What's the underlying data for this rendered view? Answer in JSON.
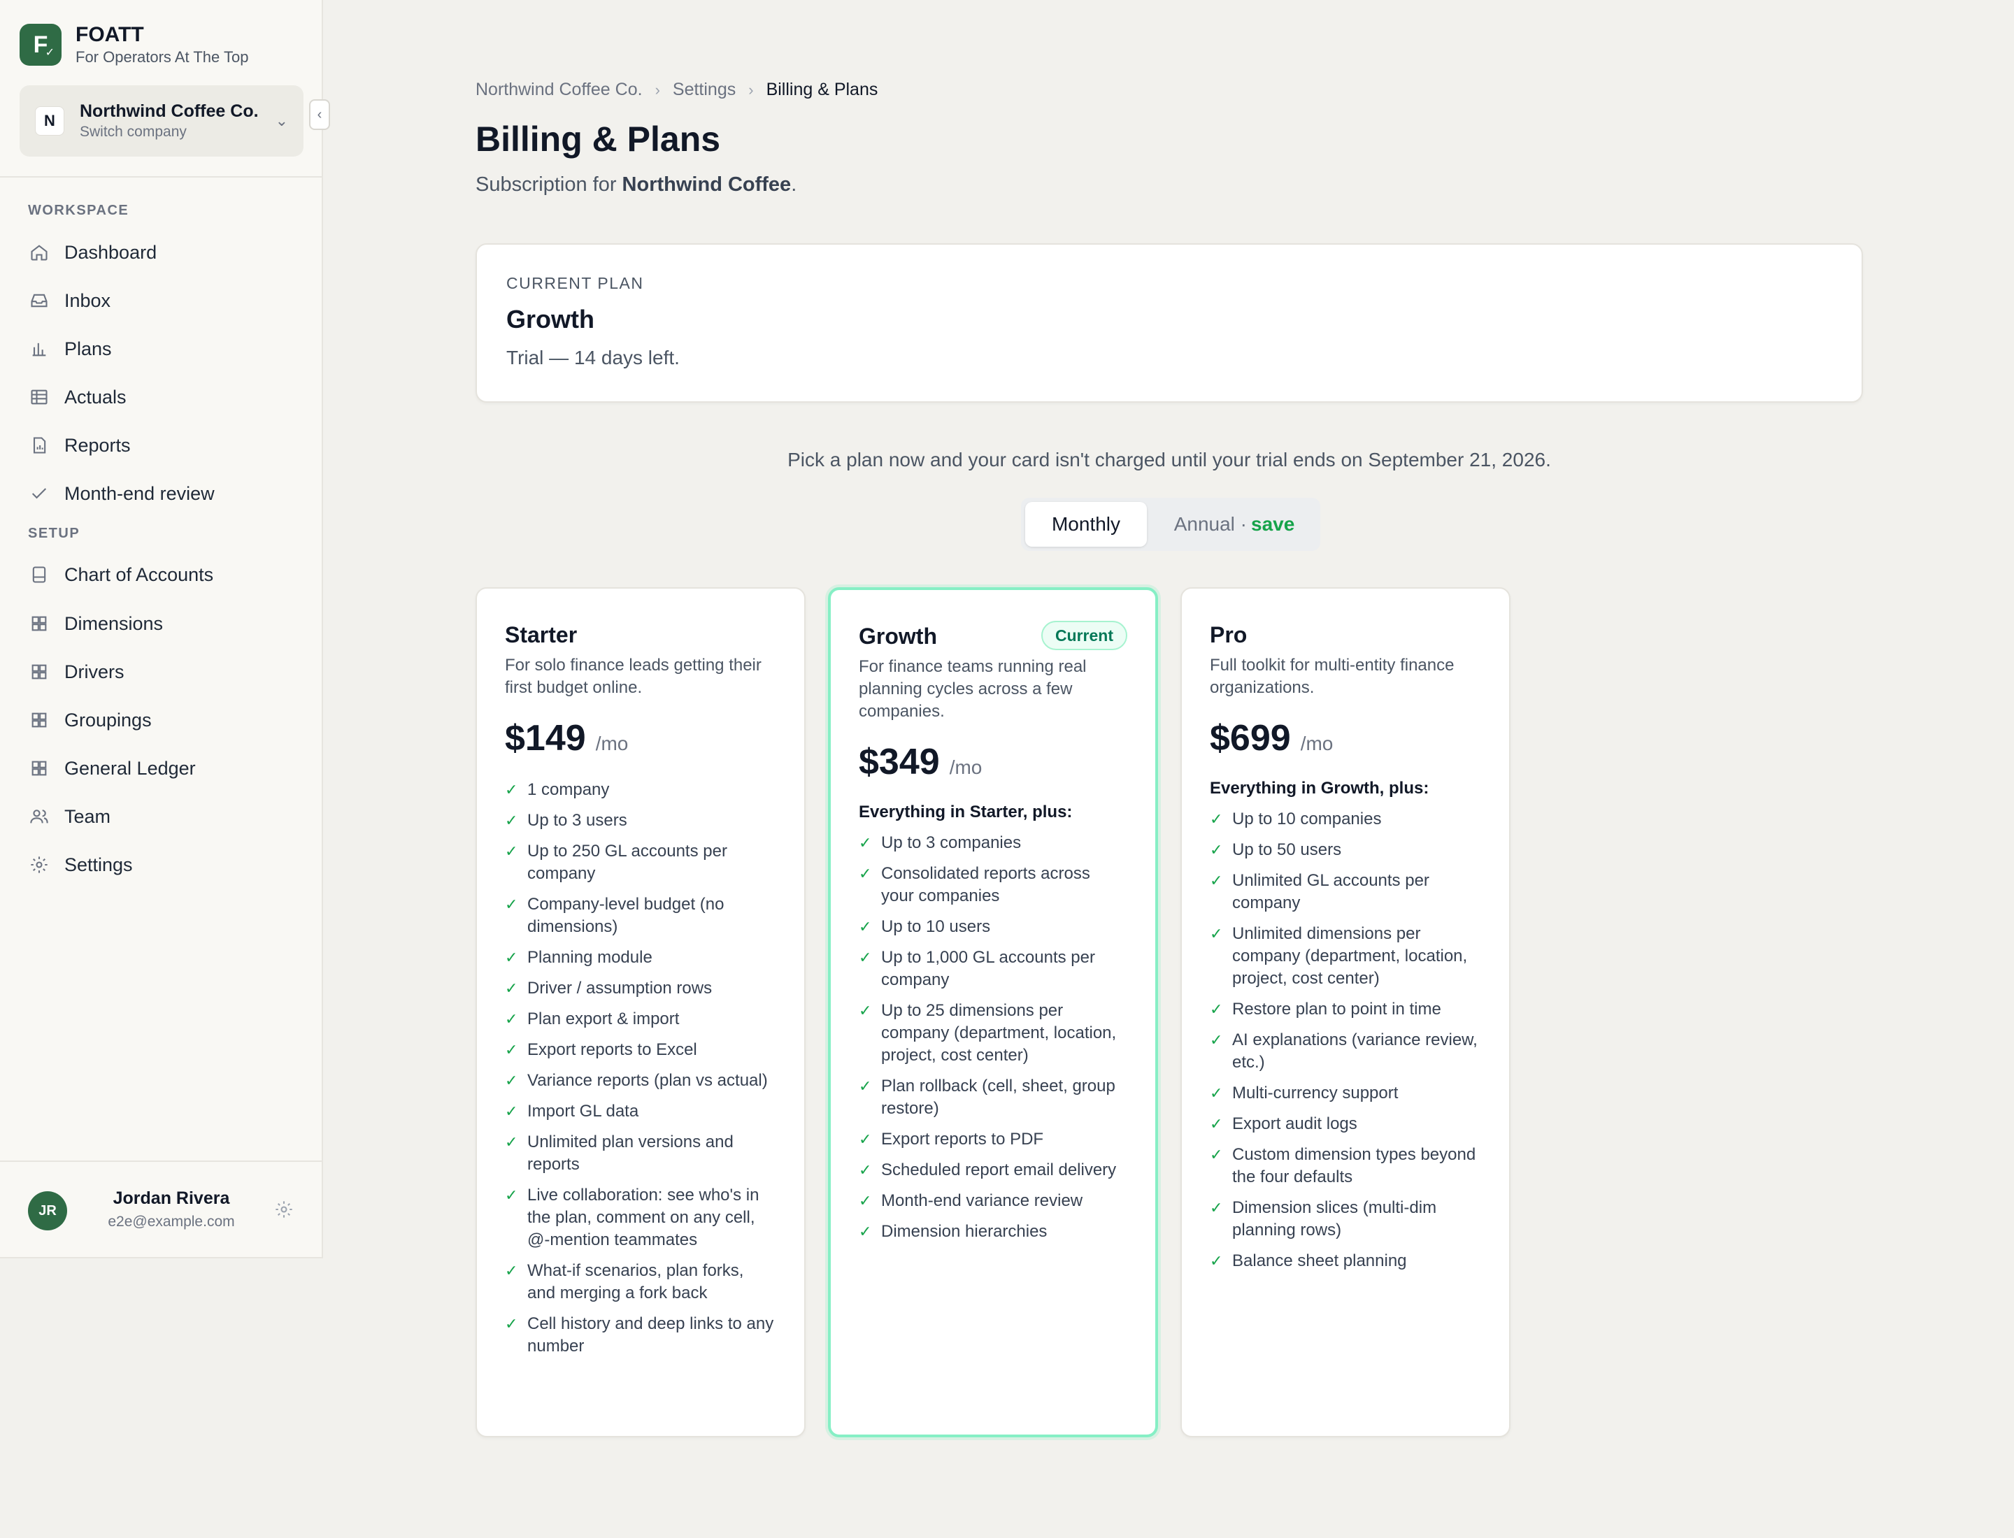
{
  "brand": {
    "logo_letter": "F",
    "name": "FOATT",
    "tagline": "For Operators At The Top"
  },
  "company": {
    "avatar": "N",
    "name": "Northwind Coffee Co.",
    "switch_label": "Switch company"
  },
  "sidebar": {
    "workspace_label": "WORKSPACE",
    "workspace_items": [
      {
        "label": "Dashboard",
        "icon": "home-icon"
      },
      {
        "label": "Inbox",
        "icon": "inbox-icon"
      },
      {
        "label": "Plans",
        "icon": "bar-chart-icon"
      },
      {
        "label": "Actuals",
        "icon": "table-icon"
      },
      {
        "label": "Reports",
        "icon": "report-icon"
      },
      {
        "label": "Month-end review",
        "icon": "check-icon"
      }
    ],
    "setup_label": "SETUP",
    "setup_items": [
      {
        "label": "Chart of Accounts",
        "icon": "ledger-icon"
      },
      {
        "label": "Dimensions",
        "icon": "grid-icon"
      },
      {
        "label": "Drivers",
        "icon": "grid-icon"
      },
      {
        "label": "Groupings",
        "icon": "grid-icon"
      },
      {
        "label": "General Ledger",
        "icon": "grid-icon"
      },
      {
        "label": "Team",
        "icon": "users-icon"
      },
      {
        "label": "Settings",
        "icon": "gear-icon"
      }
    ]
  },
  "user": {
    "initials": "JR",
    "name": "Jordan Rivera",
    "email": "e2e@example.com"
  },
  "breadcrumb": [
    "Northwind Coffee Co.",
    "Settings",
    "Billing & Plans"
  ],
  "page": {
    "title": "Billing & Plans",
    "subtitle_prefix": "Subscription for ",
    "subtitle_company": "Northwind Coffee",
    "subtitle_suffix": "."
  },
  "current_plan": {
    "label": "CURRENT PLAN",
    "name": "Growth",
    "trial": "Trial — 14 days left."
  },
  "notice": "Pick a plan now and your card isn't charged until your trial ends on September 21, 2026.",
  "billing_toggle": {
    "monthly": "Monthly",
    "annual": "Annual ·",
    "annual_save": "save",
    "selected": "Monthly"
  },
  "plans": [
    {
      "name": "Starter",
      "badge": "",
      "description": "For solo finance leads getting their first budget online.",
      "price": "$149",
      "period": "/mo",
      "intro": "",
      "features": [
        "1 company",
        "Up to 3 users",
        "Up to 250 GL accounts per company",
        "Company-level budget (no dimensions)",
        "Planning module",
        "Driver / assumption rows",
        "Plan export & import",
        "Export reports to Excel",
        "Variance reports (plan vs actual)",
        "Import GL data",
        "Unlimited plan versions and reports",
        "Live collaboration: see who's in the plan, comment on any cell, @-mention teammates",
        "What-if scenarios, plan forks, and merging a fork back",
        "Cell history and deep links to any number"
      ]
    },
    {
      "name": "Growth",
      "badge": "Current",
      "description": "For finance teams running real planning cycles across a few companies.",
      "price": "$349",
      "period": "/mo",
      "intro": "Everything in Starter, plus:",
      "features": [
        "Up to 3 companies",
        "Consolidated reports across your companies",
        "Up to 10 users",
        "Up to 1,000 GL accounts per company",
        "Up to 25 dimensions per company (department, location, project, cost center)",
        "Plan rollback (cell, sheet, group restore)",
        "Export reports to PDF",
        "Scheduled report email delivery",
        "Month-end variance review",
        "Dimension hierarchies"
      ]
    },
    {
      "name": "Pro",
      "badge": "",
      "description": "Full toolkit for multi-entity finance organizations.",
      "price": "$699",
      "period": "/mo",
      "intro": "Everything in Growth, plus:",
      "features": [
        "Up to 10 companies",
        "Up to 50 users",
        "Unlimited GL accounts per company",
        "Unlimited dimensions per company (department, location, project, cost center)",
        "Restore plan to point in time",
        "AI explanations (variance review, etc.)",
        "Multi-currency support",
        "Export audit logs",
        "Custom dimension types beyond the four defaults",
        "Dimension slices (multi-dim planning rows)",
        "Balance sheet planning"
      ]
    }
  ],
  "colors": {
    "brand": "#2f6b45",
    "accent_green": "#16a34a",
    "current_border": "#86efc5",
    "background": "#f2f1ed"
  }
}
